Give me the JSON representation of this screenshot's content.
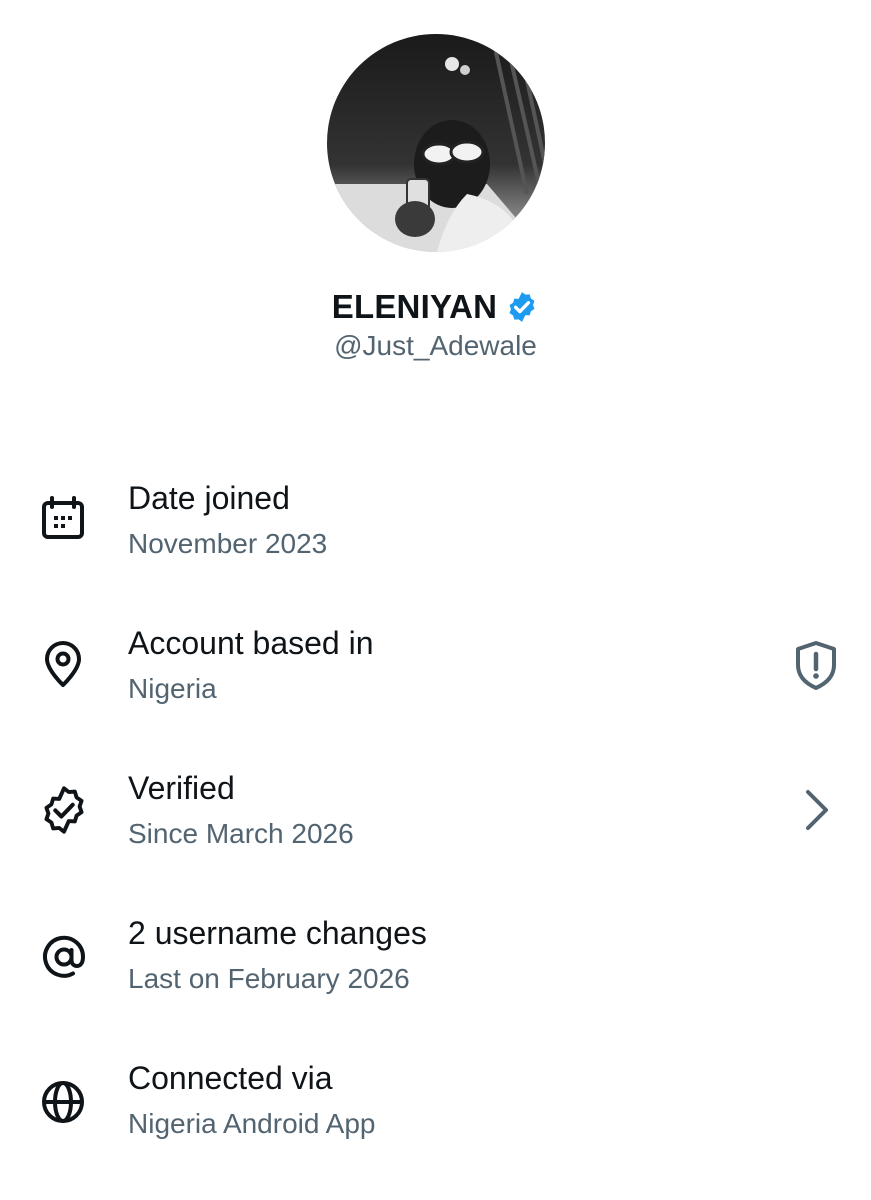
{
  "profile": {
    "display_name": "ELENIYAN",
    "handle": "@Just_Adewale",
    "verified_badge_icon": "verified-badge-icon",
    "accent_color": "#1d9bf0"
  },
  "details": [
    {
      "icon": "calendar-icon",
      "title": "Date joined",
      "subtitle": "November 2023"
    },
    {
      "icon": "location-pin-icon",
      "title": "Account based in",
      "subtitle": "Nigeria",
      "trailing_icon": "shield-alert-icon"
    },
    {
      "icon": "verified-outline-icon",
      "title": "Verified",
      "subtitle": "Since March 2026",
      "trailing_icon": "chevron-right-icon"
    },
    {
      "icon": "at-sign-icon",
      "title": "2 username changes",
      "subtitle": "Last on February 2026"
    },
    {
      "icon": "globe-icon",
      "title": "Connected via",
      "subtitle": "Nigeria Android App"
    }
  ],
  "colors": {
    "primary_text": "#0f1419",
    "secondary_text": "#536471"
  }
}
